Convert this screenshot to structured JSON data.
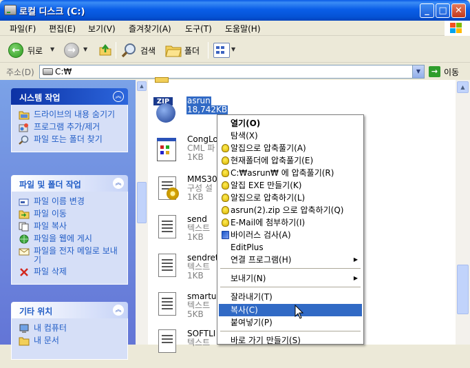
{
  "window": {
    "title": "로컬 디스크 (C:)",
    "controls": {
      "minimize": "_",
      "maximize": "□",
      "close": "✕"
    }
  },
  "menubar": {
    "items": [
      {
        "label": "파일(F)"
      },
      {
        "label": "편집(E)"
      },
      {
        "label": "보기(V)"
      },
      {
        "label": "즐겨찾기(A)"
      },
      {
        "label": "도구(T)"
      },
      {
        "label": "도움말(H)"
      }
    ]
  },
  "toolbar": {
    "back_label": "뒤로",
    "search_label": "검색",
    "folders_label": "폴더",
    "back_icon": "←",
    "forward_icon": "→",
    "dropdown_caret": "▼"
  },
  "address": {
    "label": "주소(D)",
    "value": "C:₩",
    "go_label": "이동",
    "go_icon": "→",
    "dropdown_caret": "▼"
  },
  "taskpane": {
    "system_tasks": {
      "title": "시스템 작업",
      "items": [
        {
          "label": "드라이브의 내용 숨기기",
          "icon": "folder-view-icon"
        },
        {
          "label": "프로그램 추가/제거",
          "icon": "add-remove-programs-icon"
        },
        {
          "label": "파일 또는 폴더 찾기",
          "icon": "search-icon"
        }
      ]
    },
    "file_tasks": {
      "title": "파일 및 폴더 작업",
      "items": [
        {
          "label": "파일 이름 변경",
          "icon": "rename-icon"
        },
        {
          "label": "파일 이동",
          "icon": "move-icon"
        },
        {
          "label": "파일 복사",
          "icon": "copy-icon"
        },
        {
          "label": "파일을 웹에 게시",
          "icon": "globe-icon"
        },
        {
          "label": "파일을 전자 메일로 보내기",
          "icon": "email-icon"
        },
        {
          "label": "파일 삭제",
          "icon": "delete-icon"
        }
      ]
    },
    "other_places": {
      "title": "기타 위치",
      "items": [
        {
          "label": "내 컴퓨터",
          "icon": "my-computer-icon"
        },
        {
          "label": "내 문서",
          "icon": "my-documents-icon"
        }
      ]
    },
    "chevron": "︽"
  },
  "files": [
    {
      "name": "asrun",
      "sub": "",
      "size": "18,742KB",
      "icon": "zip-file-icon",
      "selected": true
    },
    {
      "name": "CongLo",
      "sub": "CML 파",
      "size": "1KB",
      "icon": "cml-file-icon"
    },
    {
      "name": "MMS30",
      "sub": "구성 설",
      "size": "1KB",
      "icon": "config-file-icon"
    },
    {
      "name": "send",
      "sub": "텍스트",
      "size": "1KB",
      "icon": "text-file-icon"
    },
    {
      "name": "sendret",
      "sub": "텍스트",
      "size": "1KB",
      "icon": "text-file-icon"
    },
    {
      "name": "smartup",
      "sub": "텍스트",
      "size": "5KB",
      "icon": "text-file-icon"
    },
    {
      "name": "SOFTLI",
      "sub": "텍스트",
      "size": "",
      "icon": "text-file-icon"
    }
  ],
  "context_menu": {
    "items": [
      {
        "label": "열기(O)",
        "bold": true
      },
      {
        "label": "탐색(X)"
      },
      {
        "label": "알집으로 압축풀기(A)",
        "icon": true
      },
      {
        "label": "현재폴더에 압축풀기(E)",
        "icon": true
      },
      {
        "label": "C:₩asrun₩ 에 압축풀기(R)",
        "icon": true
      },
      {
        "label": "알집 EXE 만들기(K)",
        "icon": true
      },
      {
        "label": "알집으로 압축하기(L)",
        "icon": true
      },
      {
        "label": "asrun(2).zip 으로 압축하기(Q)",
        "icon": true
      },
      {
        "label": "E-Mail에 첨부하기(I)",
        "icon": true
      },
      {
        "label": "바이러스 검사(A)",
        "icon": true,
        "v3": true
      },
      {
        "label": "EditPlus"
      },
      {
        "label": "연결 프로그램(H)",
        "submenu": true
      },
      {
        "label": "보내기(N)",
        "submenu": true
      },
      {
        "label": "잘라내기(T)"
      },
      {
        "label": "복사(C)",
        "highlighted": true
      },
      {
        "label": "붙여넣기(P)"
      },
      {
        "label": "바로 가기 만들기(S)"
      }
    ],
    "submenu_arrow": "▶"
  },
  "colors": {
    "title_blue": "#0553d6",
    "task_link": "#215dc6",
    "selection": "#316ac5"
  }
}
